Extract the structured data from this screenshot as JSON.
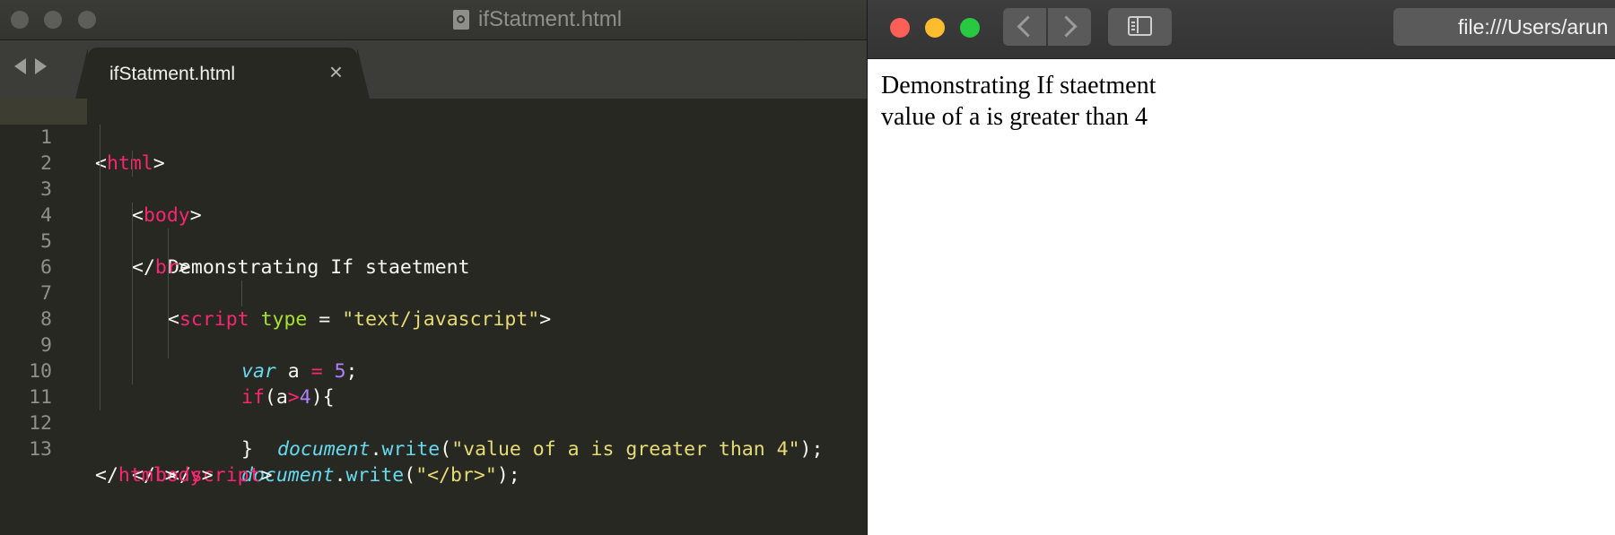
{
  "editor": {
    "window_title": "ifStatment.html",
    "tab": {
      "label": "ifStatment.html",
      "close_glyph": "×"
    },
    "lines": [
      {
        "n": "1"
      },
      {
        "n": "2"
      },
      {
        "n": "3"
      },
      {
        "n": "4"
      },
      {
        "n": "5"
      },
      {
        "n": "6"
      },
      {
        "n": "7"
      },
      {
        "n": "8"
      },
      {
        "n": "9"
      },
      {
        "n": "10"
      },
      {
        "n": "11"
      },
      {
        "n": "12"
      },
      {
        "n": "13"
      }
    ],
    "code": {
      "l1": {
        "lt": "<",
        "tag": "html",
        "gt": ">"
      },
      "l2": {
        "lt": "<",
        "tag": "body",
        "gt": ">"
      },
      "l3": {
        "text": "Demonstrating If staetment"
      },
      "l4": {
        "lt": "</",
        "tag": "br",
        "gt": ">"
      },
      "l5": {
        "lt": "<",
        "tag": "script",
        "attr": " type",
        "eq": " = ",
        "val": "\"text/javascript\"",
        "gt": ">"
      },
      "l6": {
        "kw": "var",
        "name": " a ",
        "op": "=",
        "num": " 5",
        "end": ";"
      },
      "l7": {
        "kw": "if",
        "open": "(a",
        "op": ">",
        "num": "4",
        "close": "){"
      },
      "l8": {
        "obj": "document",
        "dot": ".",
        "fn": "write",
        "open": "(",
        "str": "\"value of a is greater than 4\"",
        "close": ");"
      },
      "l9": {
        "text": "}"
      },
      "l10": {
        "obj": "document",
        "dot": ".",
        "fn": "write",
        "open": "(",
        "str": "\"</br>\"",
        "close": ");"
      },
      "l11": {
        "lt": "</",
        "tag": "script",
        "gt": ">"
      },
      "l12": {
        "lt": "</",
        "tag": "body",
        "gt": ">"
      },
      "l13": {
        "lt": "</",
        "tag": "html",
        "gt": ">"
      }
    },
    "colors": {
      "background": "#272822",
      "tag": "#f92672",
      "attr": "#a6e22e",
      "string": "#e6db74",
      "keyword": "#66d9ef",
      "number": "#ae81ff"
    }
  },
  "browser": {
    "address": "file:///Users/arun",
    "content": {
      "line1": "Demonstrating If staetment",
      "line2": "value of a is greater than 4"
    },
    "icons": [
      "back-chevron-icon",
      "forward-chevron-icon",
      "sidebar-icon"
    ]
  }
}
